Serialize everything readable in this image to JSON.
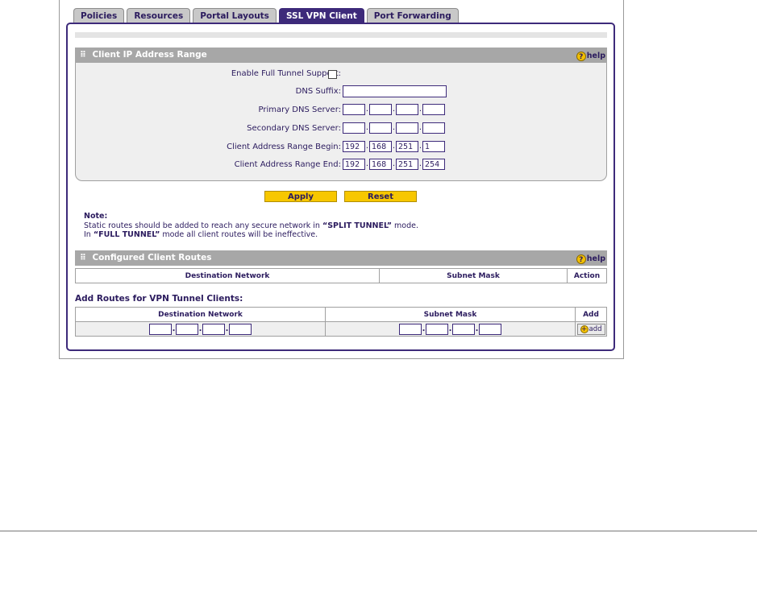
{
  "tabs": [
    {
      "label": "Policies",
      "active": false
    },
    {
      "label": "Resources",
      "active": false
    },
    {
      "label": "Portal Layouts",
      "active": false
    },
    {
      "label": "SSL VPN Client",
      "active": true
    },
    {
      "label": "Port Forwarding",
      "active": false
    }
  ],
  "client_ip_section": {
    "title": "Client IP Address Range",
    "help_label": "help",
    "enable_full_tunnel": {
      "label": "Enable Full Tunnel Support:",
      "checked": false
    },
    "dns_suffix": {
      "label": "DNS Suffix:",
      "value": ""
    },
    "primary_dns": {
      "label": "Primary DNS Server:",
      "octets": [
        "",
        "",
        "",
        ""
      ]
    },
    "secondary_dns": {
      "label": "Secondary DNS Server:",
      "octets": [
        "",
        "",
        "",
        ""
      ]
    },
    "range_begin": {
      "label": "Client Address Range Begin:",
      "octets": [
        "192",
        "168",
        "251",
        "1"
      ]
    },
    "range_end": {
      "label": "Client Address Range End:",
      "octets": [
        "192",
        "168",
        "251",
        "254"
      ]
    }
  },
  "buttons": {
    "apply": "Apply",
    "reset": "Reset"
  },
  "note": {
    "title": "Note:",
    "line1_prefix": "Static routes should be added to reach any secure network in ",
    "line1_emph": "“SPLIT TUNNEL”",
    "line1_suffix": " mode.",
    "line2_prefix": "In ",
    "line2_emph": "“FULL TUNNEL”",
    "line2_suffix": " mode all client routes will be ineffective."
  },
  "configured_routes": {
    "title": "Configured Client Routes",
    "help_label": "help",
    "columns": [
      "Destination Network",
      "Subnet Mask",
      "Action"
    ]
  },
  "add_routes": {
    "title": "Add Routes for VPN Tunnel Clients:",
    "columns": [
      "Destination Network",
      "Subnet Mask",
      "Add"
    ],
    "destination_octets": [
      "",
      "",
      "",
      ""
    ],
    "mask_octets": [
      "",
      "",
      "",
      ""
    ],
    "add_button": "add"
  },
  "colors": {
    "accent": "#3d2a7a",
    "button": "#f7c700",
    "section_bar": "#a7a7a7",
    "panel": "#efefef"
  }
}
